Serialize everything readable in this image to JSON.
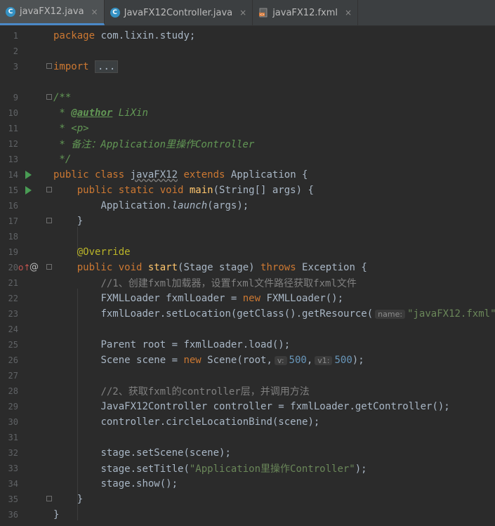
{
  "tabs": [
    {
      "label": "javaFX12.java",
      "icon": "java-class-icon",
      "color": "#3592c4",
      "active": true
    },
    {
      "label": "JavaFX12Controller.java",
      "icon": "java-class-icon",
      "color": "#3592c4",
      "active": false
    },
    {
      "label": "javaFX12.fxml",
      "icon": "fxml-file-icon",
      "color": "#d97b3b",
      "active": false
    }
  ],
  "close_glyph": "×",
  "lines": [
    {
      "n": "1",
      "top": 0
    },
    {
      "n": "2"
    },
    {
      "n": "3"
    },
    {
      "n": "9"
    },
    {
      "n": "10"
    },
    {
      "n": "11"
    },
    {
      "n": "12"
    },
    {
      "n": "13"
    },
    {
      "n": "14"
    },
    {
      "n": "15"
    },
    {
      "n": "16"
    },
    {
      "n": "17"
    },
    {
      "n": "18"
    },
    {
      "n": "19"
    },
    {
      "n": "20"
    },
    {
      "n": "21"
    },
    {
      "n": "22"
    },
    {
      "n": "23"
    },
    {
      "n": "24"
    },
    {
      "n": "25"
    },
    {
      "n": "26"
    },
    {
      "n": "27"
    },
    {
      "n": "28"
    },
    {
      "n": "29"
    },
    {
      "n": "30"
    },
    {
      "n": "31"
    },
    {
      "n": "32"
    },
    {
      "n": "33"
    },
    {
      "n": "34"
    },
    {
      "n": "35"
    },
    {
      "n": "36"
    }
  ],
  "code": {
    "l1": {
      "kw": "package",
      "rest": " com.lixin.study;"
    },
    "l3": {
      "kw": "import",
      "fold": "..."
    },
    "l9": "/**",
    "l10": {
      "star": " * ",
      "tag": "@author",
      "rest": " LiXin"
    },
    "l11": " * <p>",
    "l12": " * 备注：Application里操作Controller",
    "l13": " */",
    "l14": {
      "kw1": "public class",
      "name": "javaFX12",
      "kw2": "extends",
      "rest": " Application {"
    },
    "l15": {
      "kw": "public static void",
      "fn": "main",
      "rest": "(String[] args) {"
    },
    "l16": {
      "pre": "Application.",
      "fn": "launch",
      "rest": "(args);"
    },
    "l17": "}",
    "l19": "@Override",
    "l20": {
      "kw": "public void",
      "fn": "start",
      "mid": "(Stage stage) ",
      "kw2": "throws",
      "rest": " Exception {"
    },
    "l21": "//1、创建fxml加载器，设置fxml文件路径获取fxml文件",
    "l22": {
      "pre": "FXMLLoader fxmlLoader = ",
      "kw": "new",
      "rest": " FXMLLoader();"
    },
    "l23": {
      "pre": "fxmlLoader.setLocation(getClass().getResource(",
      "hint": "name:",
      "str": "\"javaFX12.fxml\"",
      "rest": "));"
    },
    "l25": "Parent root = fxmlLoader.load();",
    "l26": {
      "pre": "Scene scene = ",
      "kw": "new",
      "mid": " Scene(root,",
      "hint1": "v:",
      "num1": "500",
      "sep": ",",
      "hint2": "v1:",
      "num2": "500",
      "rest": ");"
    },
    "l28": "//2、获取fxml的controller层，并调用方法",
    "l29": "JavaFX12Controller controller = fxmlLoader.getController();",
    "l30": "controller.circleLocationBind(scene);",
    "l32": "stage.setScene(scene);",
    "l33": {
      "pre": "stage.setTitle(",
      "str": "\"Application里操作Controller\"",
      "rest": ");"
    },
    "l34": "stage.show();",
    "l35": "}",
    "l36": "}"
  },
  "gutter_at_glyph": "@",
  "gutter_override_glyph": "o↑"
}
